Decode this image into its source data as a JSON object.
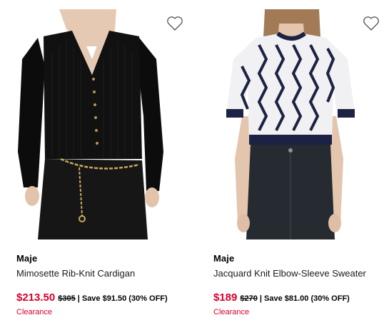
{
  "products": [
    {
      "brand": "Maje",
      "name": "Mimosette Rib-Knit Cardigan",
      "sale_price": "$213.50",
      "original_price": "$305",
      "savings": "| Save $91.50 (30% OFF)",
      "badge": "Clearance",
      "favorite_icon": "heart-outline-icon"
    },
    {
      "brand": "Maje",
      "name": "Jacquard Knit Elbow-Sleeve Sweater",
      "sale_price": "$189",
      "original_price": "$270",
      "savings": "| Save $81.00 (30% OFF)",
      "badge": "Clearance",
      "favorite_icon": "heart-outline-icon"
    }
  ],
  "colors": {
    "sale_price": "#d5002f",
    "badge": "#d5002f",
    "text": "#000000"
  }
}
